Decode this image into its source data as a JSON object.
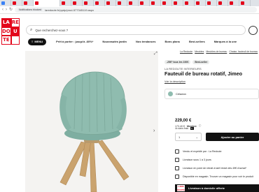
{
  "browser": {
    "active_tab_title": "Notifications (dock) - laredoute",
    "url_badge": "Notifications blocked",
    "url": "laredoute.fr/ppdp/prod-577345119.aspx"
  },
  "logo": {
    "letters": [
      "LA",
      "RE",
      "DO",
      "U",
      "TE",
      ""
    ]
  },
  "search": {
    "placeholder": "Que recherchez-vous ?"
  },
  "menu": {
    "button_label": "MENU",
    "items": [
      "Prêt à porter : jusqu'à -60%*",
      "Nouveautés jardin",
      "Nos tendances",
      "Bons plans",
      "Best-sellers",
      "Marques à la une"
    ]
  },
  "breadcrumb": [
    "La Redoute",
    "Meubles",
    "Meubles de bureau",
    "Chaise, fauteuil de bureau"
  ],
  "promo": {
    "badge1": "-25€* tous les 100€",
    "badge2": "Best-seller"
  },
  "product": {
    "brand": "LA REDOUTE INTERIEURS",
    "title": "Fauteuil de bureau rotatif, Jimeo",
    "see_description": "Voir la description",
    "color_label": "Céladon",
    "price": "229,00 €",
    "member_price": "173,40 €",
    "member_label": "Membre",
    "klarna_text": "4x sans frais",
    "qty_value": "1",
    "add_to_cart": "Ajouter au panier"
  },
  "delivery": [
    "Vendu et expédié par : La Redoute",
    "Livraison sous 1 à 3 jours",
    "Livraison en point de retrait à tarif réduit dès 49€ d'achat*",
    "Disponible en magasin. Trouver un magasin pour voir le produit"
  ],
  "bottom_banner": {
    "text": "Livraison à domicile offerte"
  },
  "colors": {
    "brand_red": "#e3051b",
    "product_green": "#8fbcaf"
  }
}
